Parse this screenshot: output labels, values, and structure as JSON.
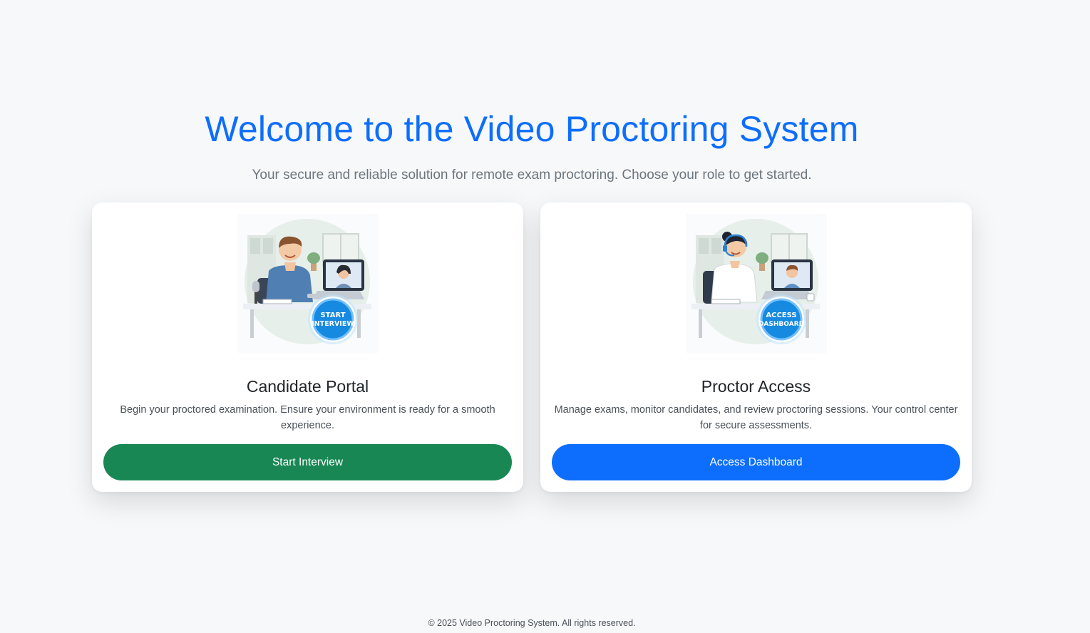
{
  "header": {
    "title": "Welcome to the Video Proctoring System",
    "subtitle": "Your secure and reliable solution for remote exam proctoring. Choose your role to get started."
  },
  "cards": [
    {
      "title": "Candidate Portal",
      "description": "Begin your proctored examination. Ensure your environment is ready for a smooth experience.",
      "button_label": "Start Interview",
      "badge_line1": "START",
      "badge_line2": "INTERVIEW",
      "color": "#198754"
    },
    {
      "title": "Proctor Access",
      "description": "Manage exams, monitor candidates, and review proctoring sessions. Your control center for secure assessments.",
      "button_label": "Access Dashboard",
      "badge_line1": "ACCESS",
      "badge_line2": "DASHBOARD",
      "color": "#0d6efd"
    }
  ],
  "footer": {
    "text": "© 2025 Video Proctoring System. All rights reserved."
  },
  "colors": {
    "accent": "#0d6efd",
    "success": "#198754",
    "background": "#f7f8fa"
  }
}
